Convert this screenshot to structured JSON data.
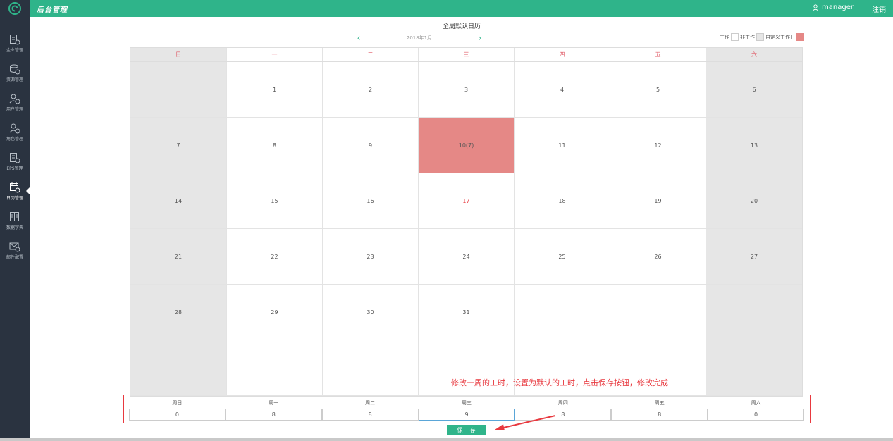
{
  "header": {
    "app_title": "后台管理",
    "user_name": "manager",
    "logout_label": "注销"
  },
  "sidebar": {
    "items": [
      {
        "label": "企业管理",
        "icon": "enterprise-icon"
      },
      {
        "label": "资源管理",
        "icon": "resource-icon"
      },
      {
        "label": "用户管理",
        "icon": "user-icon"
      },
      {
        "label": "角色管理",
        "icon": "role-icon"
      },
      {
        "label": "EPS管理",
        "icon": "eps-icon"
      },
      {
        "label": "日历管理",
        "icon": "calendar-icon",
        "active": true
      },
      {
        "label": "数据字典",
        "icon": "dictionary-icon"
      },
      {
        "label": "邮件配置",
        "icon": "mail-icon"
      }
    ]
  },
  "calendar": {
    "title": "全局默认日历",
    "month": "2018年1月",
    "weekdays": [
      "日",
      "一",
      "二",
      "三",
      "四",
      "五",
      "六"
    ],
    "legend": {
      "work": "工作",
      "nonwork": "非工作",
      "custom": "自定义工作日"
    },
    "colors": {
      "accent": "#2fb48a",
      "custom_day": "#e58886",
      "nonwork": "#e6e6e6",
      "today": "#e8393f"
    },
    "rows": [
      [
        "",
        "1",
        "2",
        "3",
        "4",
        "5",
        "6"
      ],
      [
        "7",
        "8",
        "9",
        "10(7)",
        "11",
        "12",
        "13"
      ],
      [
        "14",
        "15",
        "16",
        "17",
        "18",
        "19",
        "20"
      ],
      [
        "21",
        "22",
        "23",
        "24",
        "25",
        "26",
        "27"
      ],
      [
        "28",
        "29",
        "30",
        "31",
        "",
        "",
        ""
      ],
      [
        "",
        "",
        "",
        "",
        "",
        "",
        ""
      ]
    ]
  },
  "annotation": "修改一周的工时，设置为默认的工时，点击保存按钮，修改完成",
  "hours": {
    "labels": [
      "周日",
      "周一",
      "周二",
      "周三",
      "周四",
      "周五",
      "周六"
    ],
    "values": [
      "0",
      "8",
      "8",
      "9",
      "8",
      "8",
      "0"
    ]
  },
  "save_label": "保存"
}
